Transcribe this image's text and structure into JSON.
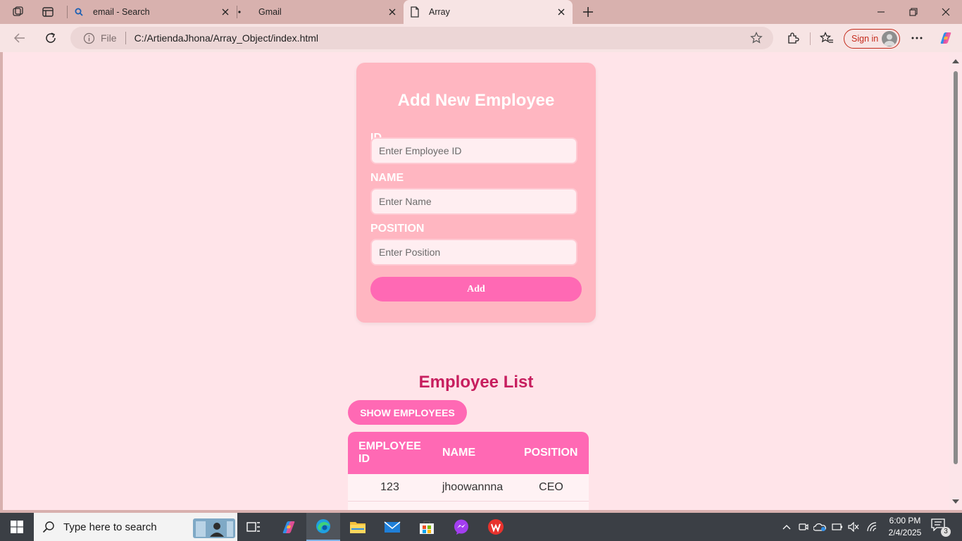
{
  "browser": {
    "tabs": [
      {
        "title": "email - Search",
        "icon": "search-icon"
      },
      {
        "title": "Gmail",
        "icon": "gmail-icon"
      },
      {
        "title": "Array",
        "icon": "page-icon",
        "active": true
      }
    ],
    "address": {
      "scheme_label": "File",
      "url": "C:/ArtiendaJhona/Array_Object/index.html"
    },
    "sign_in_label": "Sign in",
    "colors": {
      "tabstrip": "#d8b1ae",
      "toolbar": "#f7e4e4",
      "sign_in": "#c42b1c"
    }
  },
  "page": {
    "form": {
      "title": "Add New Employee",
      "id_label": "ID",
      "id_placeholder": "Enter Employee ID",
      "name_label": "NAME",
      "name_placeholder": "Enter Name",
      "position_label": "POSITION",
      "position_placeholder": "Enter Position",
      "add_label": "Add"
    },
    "list": {
      "title": "Employee List",
      "show_label": "SHOW EMPLOYEES",
      "headers": [
        "EMPLOYEE ID",
        "NAME",
        "POSITION"
      ],
      "rows": [
        {
          "id": "123",
          "name": "jhoowannna",
          "position": "CEO"
        }
      ]
    },
    "colors": {
      "background": "#ffe4e9",
      "card": "#ffb6c1",
      "accent": "#ff69b4",
      "title": "#c71e5e"
    }
  },
  "taskbar": {
    "search_placeholder": "Type here to search",
    "time": "6:00 PM",
    "date": "2/4/2025",
    "notification_count": "3"
  }
}
